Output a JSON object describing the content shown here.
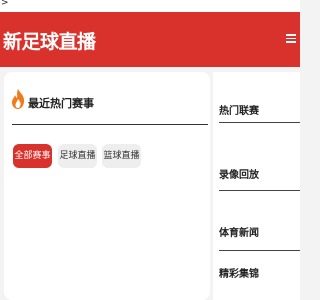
{
  "top_strip": {
    "text": ">"
  },
  "header": {
    "site_title": "新足球直播",
    "menu_icon": "menu-icon"
  },
  "main": {
    "section_title": "最近热门赛事",
    "section_icon": "flame-icon",
    "tabs": [
      {
        "label": "全部赛事",
        "active": true
      },
      {
        "label": "足球直播",
        "active": false
      },
      {
        "label": "篮球直播",
        "active": false
      }
    ]
  },
  "sidebar": {
    "items": [
      {
        "label": "热门联赛"
      },
      {
        "label": "录像回放"
      },
      {
        "label": "体育新闻"
      },
      {
        "label": "精彩集锦"
      }
    ]
  },
  "colors": {
    "brand_red": "#d9322c",
    "flame_orange": "#f07b1c"
  }
}
